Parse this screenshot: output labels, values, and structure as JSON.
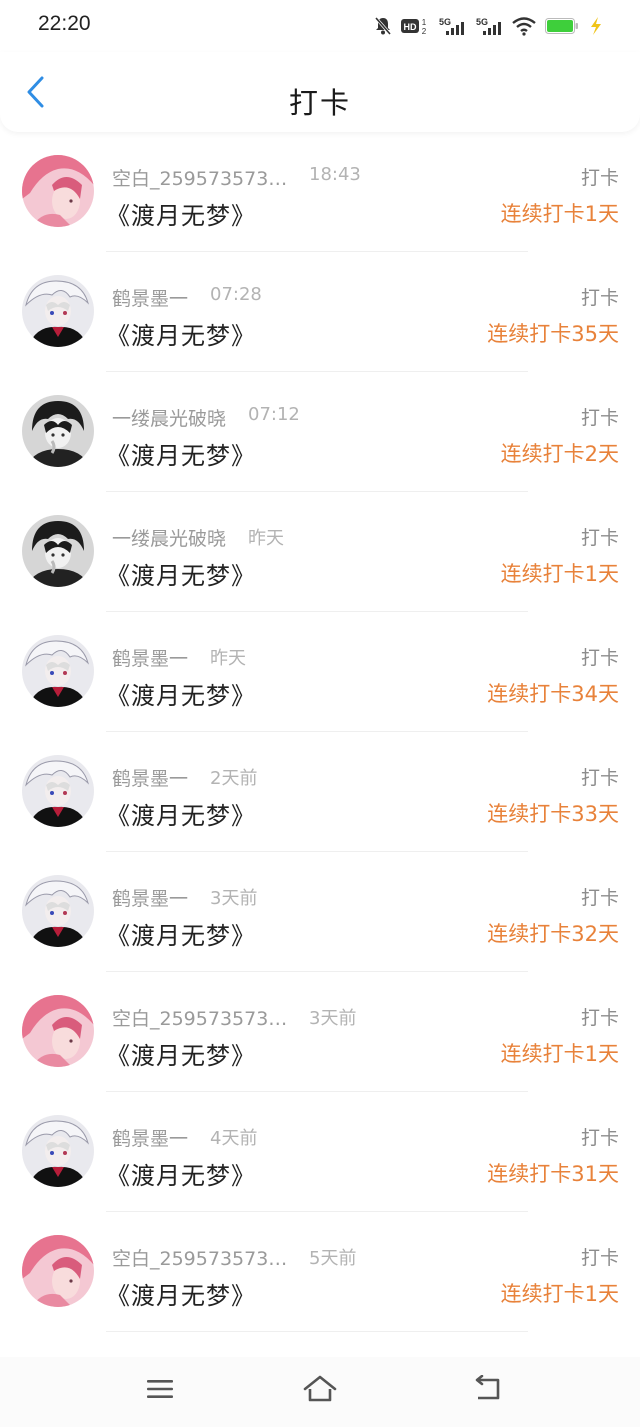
{
  "status_bar": {
    "time": "22:20",
    "network_1": "5G",
    "network_2": "5G",
    "hd_label": "HD"
  },
  "header": {
    "title": "打卡"
  },
  "colors": {
    "accent": "#e8823a",
    "back": "#2f8de4"
  },
  "items": [
    {
      "user": "空白_259573573…",
      "time": "18:43",
      "content": "《渡月无梦》",
      "type": "打卡",
      "streak": "连续打卡1天",
      "avatar": "pink-hair-avatar"
    },
    {
      "user": "鹤景墨一",
      "time": "07:28",
      "content": "《渡月无梦》",
      "type": "打卡",
      "streak": "连续打卡35天",
      "avatar": "white-hair-avatar"
    },
    {
      "user": "一缕晨光破晓",
      "time": "07:12",
      "content": "《渡月无梦》",
      "type": "打卡",
      "streak": "连续打卡2天",
      "avatar": "dark-hair-avatar"
    },
    {
      "user": "一缕晨光破晓",
      "time": "昨天",
      "content": "《渡月无梦》",
      "type": "打卡",
      "streak": "连续打卡1天",
      "avatar": "dark-hair-avatar"
    },
    {
      "user": "鹤景墨一",
      "time": "昨天",
      "content": "《渡月无梦》",
      "type": "打卡",
      "streak": "连续打卡34天",
      "avatar": "white-hair-avatar"
    },
    {
      "user": "鹤景墨一",
      "time": "2天前",
      "content": "《渡月无梦》",
      "type": "打卡",
      "streak": "连续打卡33天",
      "avatar": "white-hair-avatar"
    },
    {
      "user": "鹤景墨一",
      "time": "3天前",
      "content": "《渡月无梦》",
      "type": "打卡",
      "streak": "连续打卡32天",
      "avatar": "white-hair-avatar"
    },
    {
      "user": "空白_259573573…",
      "time": "3天前",
      "content": "《渡月无梦》",
      "type": "打卡",
      "streak": "连续打卡1天",
      "avatar": "pink-hair-avatar"
    },
    {
      "user": "鹤景墨一",
      "time": "4天前",
      "content": "《渡月无梦》",
      "type": "打卡",
      "streak": "连续打卡31天",
      "avatar": "white-hair-avatar"
    },
    {
      "user": "空白_259573573…",
      "time": "5天前",
      "content": "《渡月无梦》",
      "type": "打卡",
      "streak": "连续打卡1天",
      "avatar": "pink-hair-avatar"
    }
  ],
  "nav_bar": {
    "menu_icon": "menu-icon",
    "home_icon": "home-icon",
    "back_icon": "back-icon"
  }
}
